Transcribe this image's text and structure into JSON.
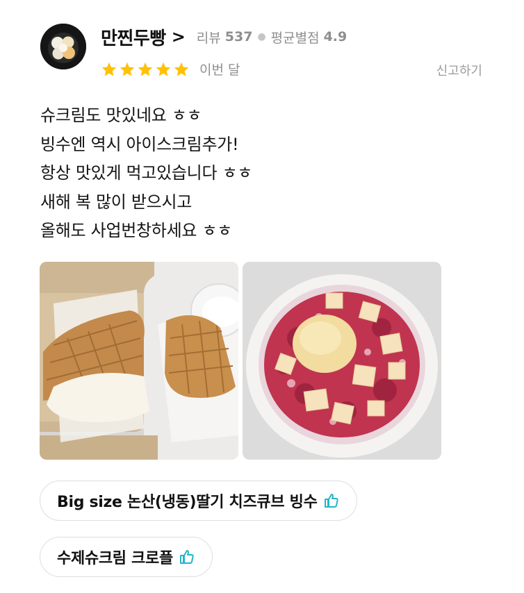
{
  "review": {
    "shop_name": "만찐두빵",
    "meta": {
      "review_label": "리뷰",
      "review_count": "537",
      "avg_label": "평균별점",
      "avg_rating": "4.9"
    },
    "rating": 5,
    "rating_max": 5,
    "date_text": "이번 달",
    "report_label": "신고하기",
    "text_lines": [
      "슈크림도 맛있네요 ㅎㅎ",
      "빙수엔 역시 아이스크림추가!",
      "항상 맛있게 먹고있습니다 ㅎㅎ",
      "새해 복 많이 받으시고",
      "올해도 사업번창하세요 ㅎㅎ"
    ],
    "menu_tags": [
      {
        "label": "Big size 논산(냉동)딸기 치즈큐브 빙수",
        "icon": "thumbs-up-icon"
      },
      {
        "label": "수제슈크림 크로플",
        "icon": "thumbs-up-icon"
      }
    ]
  },
  "colors": {
    "star": "#FFC107",
    "thumb_icon": "#24B5C6",
    "muted_text": "#8E8E8E"
  }
}
